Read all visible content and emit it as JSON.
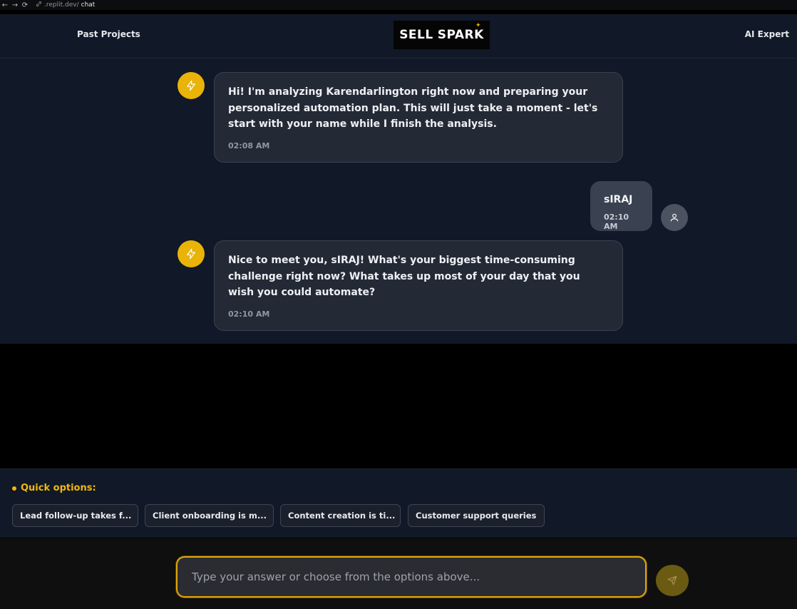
{
  "browser": {
    "back_icon": "arrow-left-icon",
    "forward_icon": "arrow-right-icon",
    "reload_icon": "reload-icon",
    "url_host": ".replit.dev/",
    "url_path": "chat"
  },
  "header": {
    "left_link": "Past Projects",
    "right_link": "AI Expert",
    "logo_text_left": "SELL",
    "logo_text_right": "SPARK"
  },
  "messages": [
    {
      "role": "assistant",
      "text": "Hi! I'm analyzing Karendarlington right now and preparing your personalized automation plan. This will just take a moment - let's start with your name while I finish the analysis.",
      "time": "02:08 AM"
    },
    {
      "role": "user",
      "text": "sIRAJ",
      "time": "02:10 AM"
    },
    {
      "role": "assistant",
      "text": "Nice to meet you, sIRAJ! What's your biggest time-consuming challenge right now? What takes up most of your day that you wish you could automate?",
      "time": "02:10 AM"
    }
  ],
  "quick_options": {
    "title": "Quick options:",
    "options": [
      "Lead follow-up takes f...",
      "Client onboarding is m...",
      "Content creation is ti...",
      "Customer support queries"
    ]
  },
  "composer": {
    "placeholder": "Type your answer or choose from the options above...",
    "value": ""
  },
  "colors": {
    "accent": "#eab308",
    "background": "#111827",
    "bubble": "#232a36"
  }
}
